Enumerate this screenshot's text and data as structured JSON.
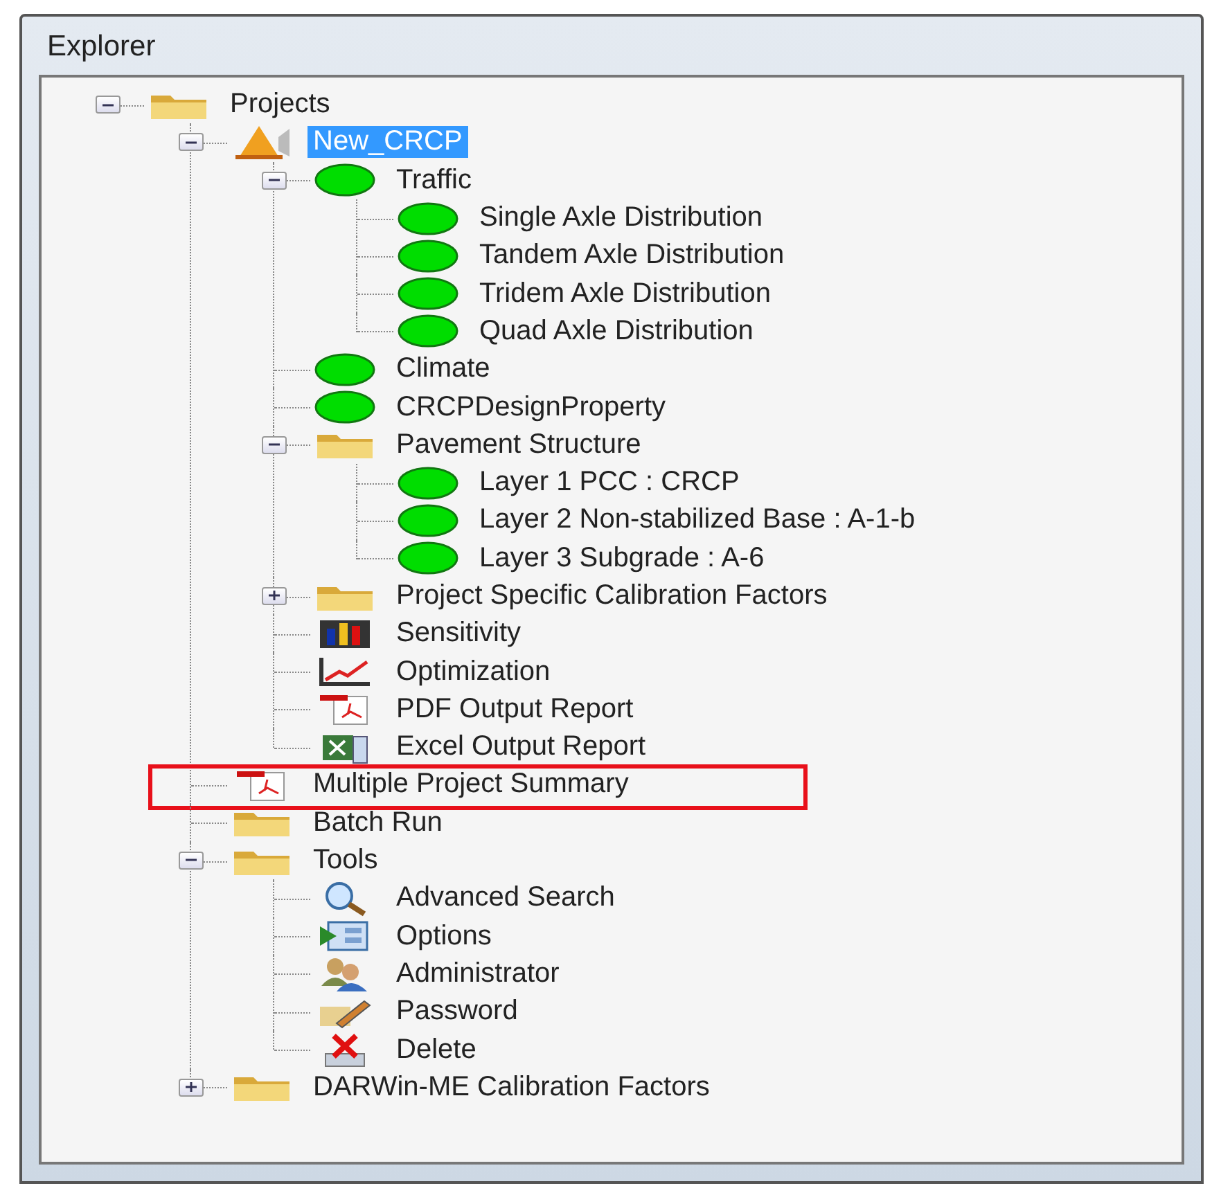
{
  "window": {
    "title": "Explorer"
  },
  "tree": [
    {
      "label": "Projects",
      "kind": "folder",
      "selected": false,
      "expanded": true,
      "children": [
        {
          "label": "New_CRCP",
          "kind": "project",
          "selected": true,
          "expanded": true,
          "children": [
            {
              "label": "Traffic",
              "kind": "status",
              "selected": false,
              "expanded": true,
              "children": [
                {
                  "label": "Single Axle Distribution",
                  "kind": "status",
                  "selected": false
                },
                {
                  "label": "Tandem Axle Distribution",
                  "kind": "status",
                  "selected": false
                },
                {
                  "label": "Tridem Axle Distribution",
                  "kind": "status",
                  "selected": false
                },
                {
                  "label": "Quad Axle Distribution",
                  "kind": "status",
                  "selected": false
                }
              ]
            },
            {
              "label": "Climate",
              "kind": "status",
              "selected": false
            },
            {
              "label": "CRCPDesignProperty",
              "kind": "status",
              "selected": false
            },
            {
              "label": "Pavement Structure",
              "kind": "folder",
              "selected": false,
              "expanded": true,
              "children": [
                {
                  "label": "Layer 1 PCC : CRCP",
                  "kind": "status",
                  "selected": false
                },
                {
                  "label": "Layer 2 Non-stabilized Base : A-1-b",
                  "kind": "status",
                  "selected": false
                },
                {
                  "label": "Layer 3 Subgrade : A-6",
                  "kind": "status",
                  "selected": false
                }
              ]
            },
            {
              "label": "Project Specific Calibration Factors",
              "kind": "folder",
              "selected": false,
              "expanded": false
            },
            {
              "label": "Sensitivity",
              "kind": "analysis",
              "selected": false
            },
            {
              "label": "Optimization",
              "kind": "chart",
              "selected": false
            },
            {
              "label": "PDF Output Report",
              "kind": "report",
              "selected": false
            },
            {
              "label": "Excel Output Report",
              "kind": "sheet",
              "selected": false
            }
          ]
        },
        {
          "label": "Multiple Project Summary",
          "kind": "report",
          "selected": false,
          "highlighted": true
        },
        {
          "label": "Batch Run",
          "kind": "folder",
          "selected": false
        },
        {
          "label": "Tools",
          "kind": "folder",
          "selected": false,
          "expanded": true,
          "children": [
            {
              "label": "Advanced Search",
              "kind": "search",
              "selected": false
            },
            {
              "label": "Options",
              "kind": "options",
              "selected": false
            },
            {
              "label": "Administrator",
              "kind": "users",
              "selected": false
            },
            {
              "label": "Password",
              "kind": "password",
              "selected": false
            },
            {
              "label": "Delete",
              "kind": "delete",
              "selected": false
            }
          ]
        },
        {
          "label": "DARWin-ME Calibration Factors",
          "kind": "folder",
          "selected": false,
          "expanded": false
        }
      ]
    }
  ]
}
